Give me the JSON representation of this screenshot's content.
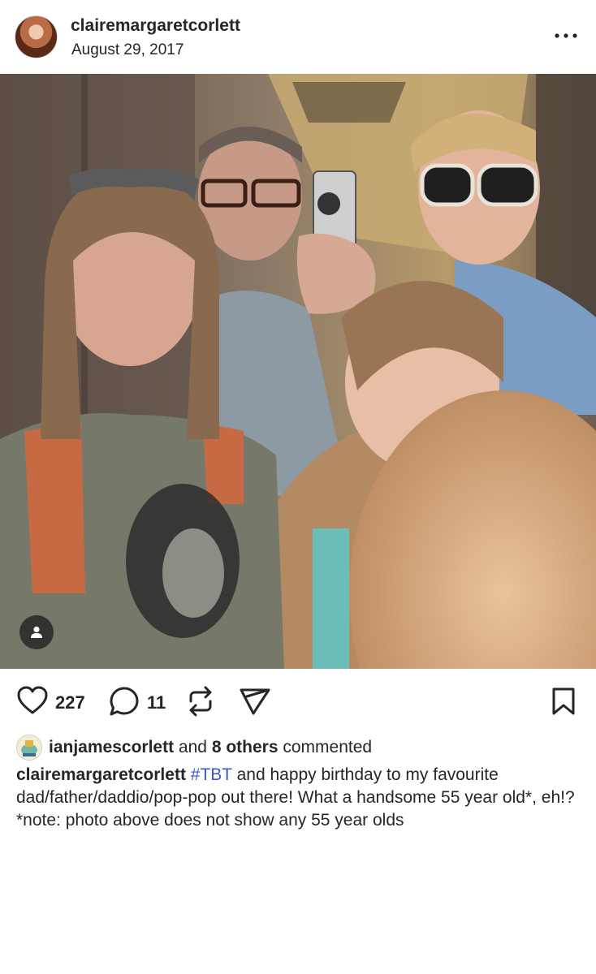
{
  "post": {
    "username": "clairemargaretcorlett",
    "date": "August 29, 2017"
  },
  "icons": {
    "more": "more-horizontal-icon",
    "user_tag": "user-tag-icon",
    "like": "heart-icon",
    "comment": "comment-bubble-icon",
    "repost": "repost-icon",
    "share": "send-icon",
    "save": "bookmark-icon"
  },
  "actions": {
    "likes": "227",
    "comments": "11"
  },
  "commenters": {
    "name": "ianjamescorlett",
    "and": "and",
    "others": "8 others",
    "suffix": "commented"
  },
  "caption": {
    "username": "clairemargaretcorlett",
    "hashtag": "#TBT",
    "text": " and happy birthday to my favourite dad/father/daddio/pop-pop out there! What a handsome 55 year old*, eh!?",
    "note": "*note: photo above does not show any 55 year olds"
  },
  "colors": {
    "text": "#262626",
    "hashtag": "#3b57c9",
    "background": "#ffffff"
  }
}
